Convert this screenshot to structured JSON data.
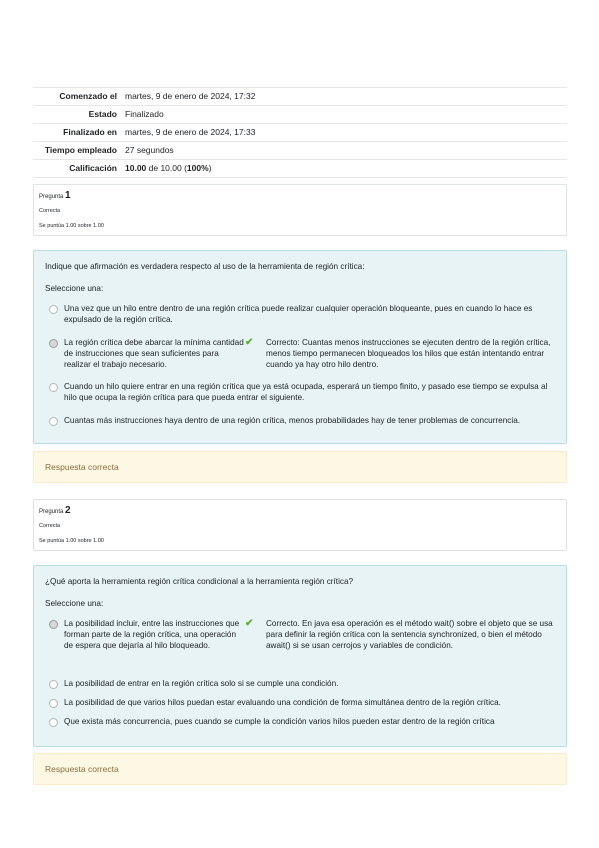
{
  "summary": {
    "rows": [
      {
        "label": "Comenzado el",
        "value": "martes, 9 de enero de 2024, 17:32"
      },
      {
        "label": "Estado",
        "value": "Finalizado"
      },
      {
        "label": "Finalizado en",
        "value": "martes, 9 de enero de 2024, 17:33"
      },
      {
        "label": "Tiempo empleado",
        "value": "27 segundos"
      },
      {
        "label": "Calificación",
        "value_bold": "10.00",
        "value_mid": " de 10.00 (",
        "value_pct": "100%",
        "value_end": ")"
      }
    ]
  },
  "questions": [
    {
      "label": "Pregunta",
      "number": "1",
      "state": "Correcta",
      "grade": "Se puntúa 1.00 sobre 1.00",
      "text": "Indique que afirmación es verdadera respecto al uso de la herramienta de región crítica:",
      "prompt": "Seleccione una:",
      "options": [
        "Una vez que un hilo entre dentro de una región crítica puede realizar cualquier operación bloqueante, pues en cuando lo hace es expulsado de la región crítica.",
        "La región crítica debe abarcar la mínima cantidad de instrucciones que sean suficientes para realizar el trabajo necesario.",
        "Cuando un hilo quiere entrar en una región crítica que ya está ocupada, esperará un tiempo finito, y pasado ese tiempo se expulsa al hilo que ocupa la región crítica para que pueda entrar el siguiente.",
        "Cuantas más instrucciones haya dentro de una región crítica, menos probabilidades hay de tener problemas de concurrencia."
      ],
      "feedback": "Correcto: Cuantas menos instrucciones se ejecuten dentro de la región crítica, menos tiempo permanecen bloqueados los hilos que están intentando entrar cuando ya hay otro hilo dentro.",
      "outcome": "Respuesta correcta"
    },
    {
      "label": "Pregunta",
      "number": "2",
      "state": "Correcta",
      "grade": "Se puntúa 1.00 sobre 1.00",
      "text": "¿Qué aporta la herramienta región crítica condicional a la herramienta región crítica?",
      "prompt": "Seleccione una:",
      "options": [
        "La posibilidad incluir, entre las instrucciones que forman parte de la región crítica, una operación de espera que dejaría al hilo bloqueado.",
        "La posibilidad de entrar en la región crítica solo si se cumple una condición.",
        "La posibilidad de que varios hilos puedan estar evaluando una condición de forma simultánea dentro de la región crítica.",
        "Que exista más concurrencia, pues cuando se cumple la condición varios hilos pueden estar dentro de la región crítica"
      ],
      "feedback": "Correcto. En java esa operación es el método wait() sobre el objeto que se usa para definir la región crítica con la sentencia synchronized, o bien el método await() si se usan cerrojos y variables de condición.",
      "outcome": "Respuesta correcta"
    }
  ],
  "icons": {
    "selected": "radio-selected-icon",
    "correct": "check-icon"
  },
  "colors": {
    "formulation_bg": "#e7f3f5",
    "outcome_bg": "#fcf8e3",
    "outcome_text": "#8a6d3b",
    "check": "#59b230"
  }
}
